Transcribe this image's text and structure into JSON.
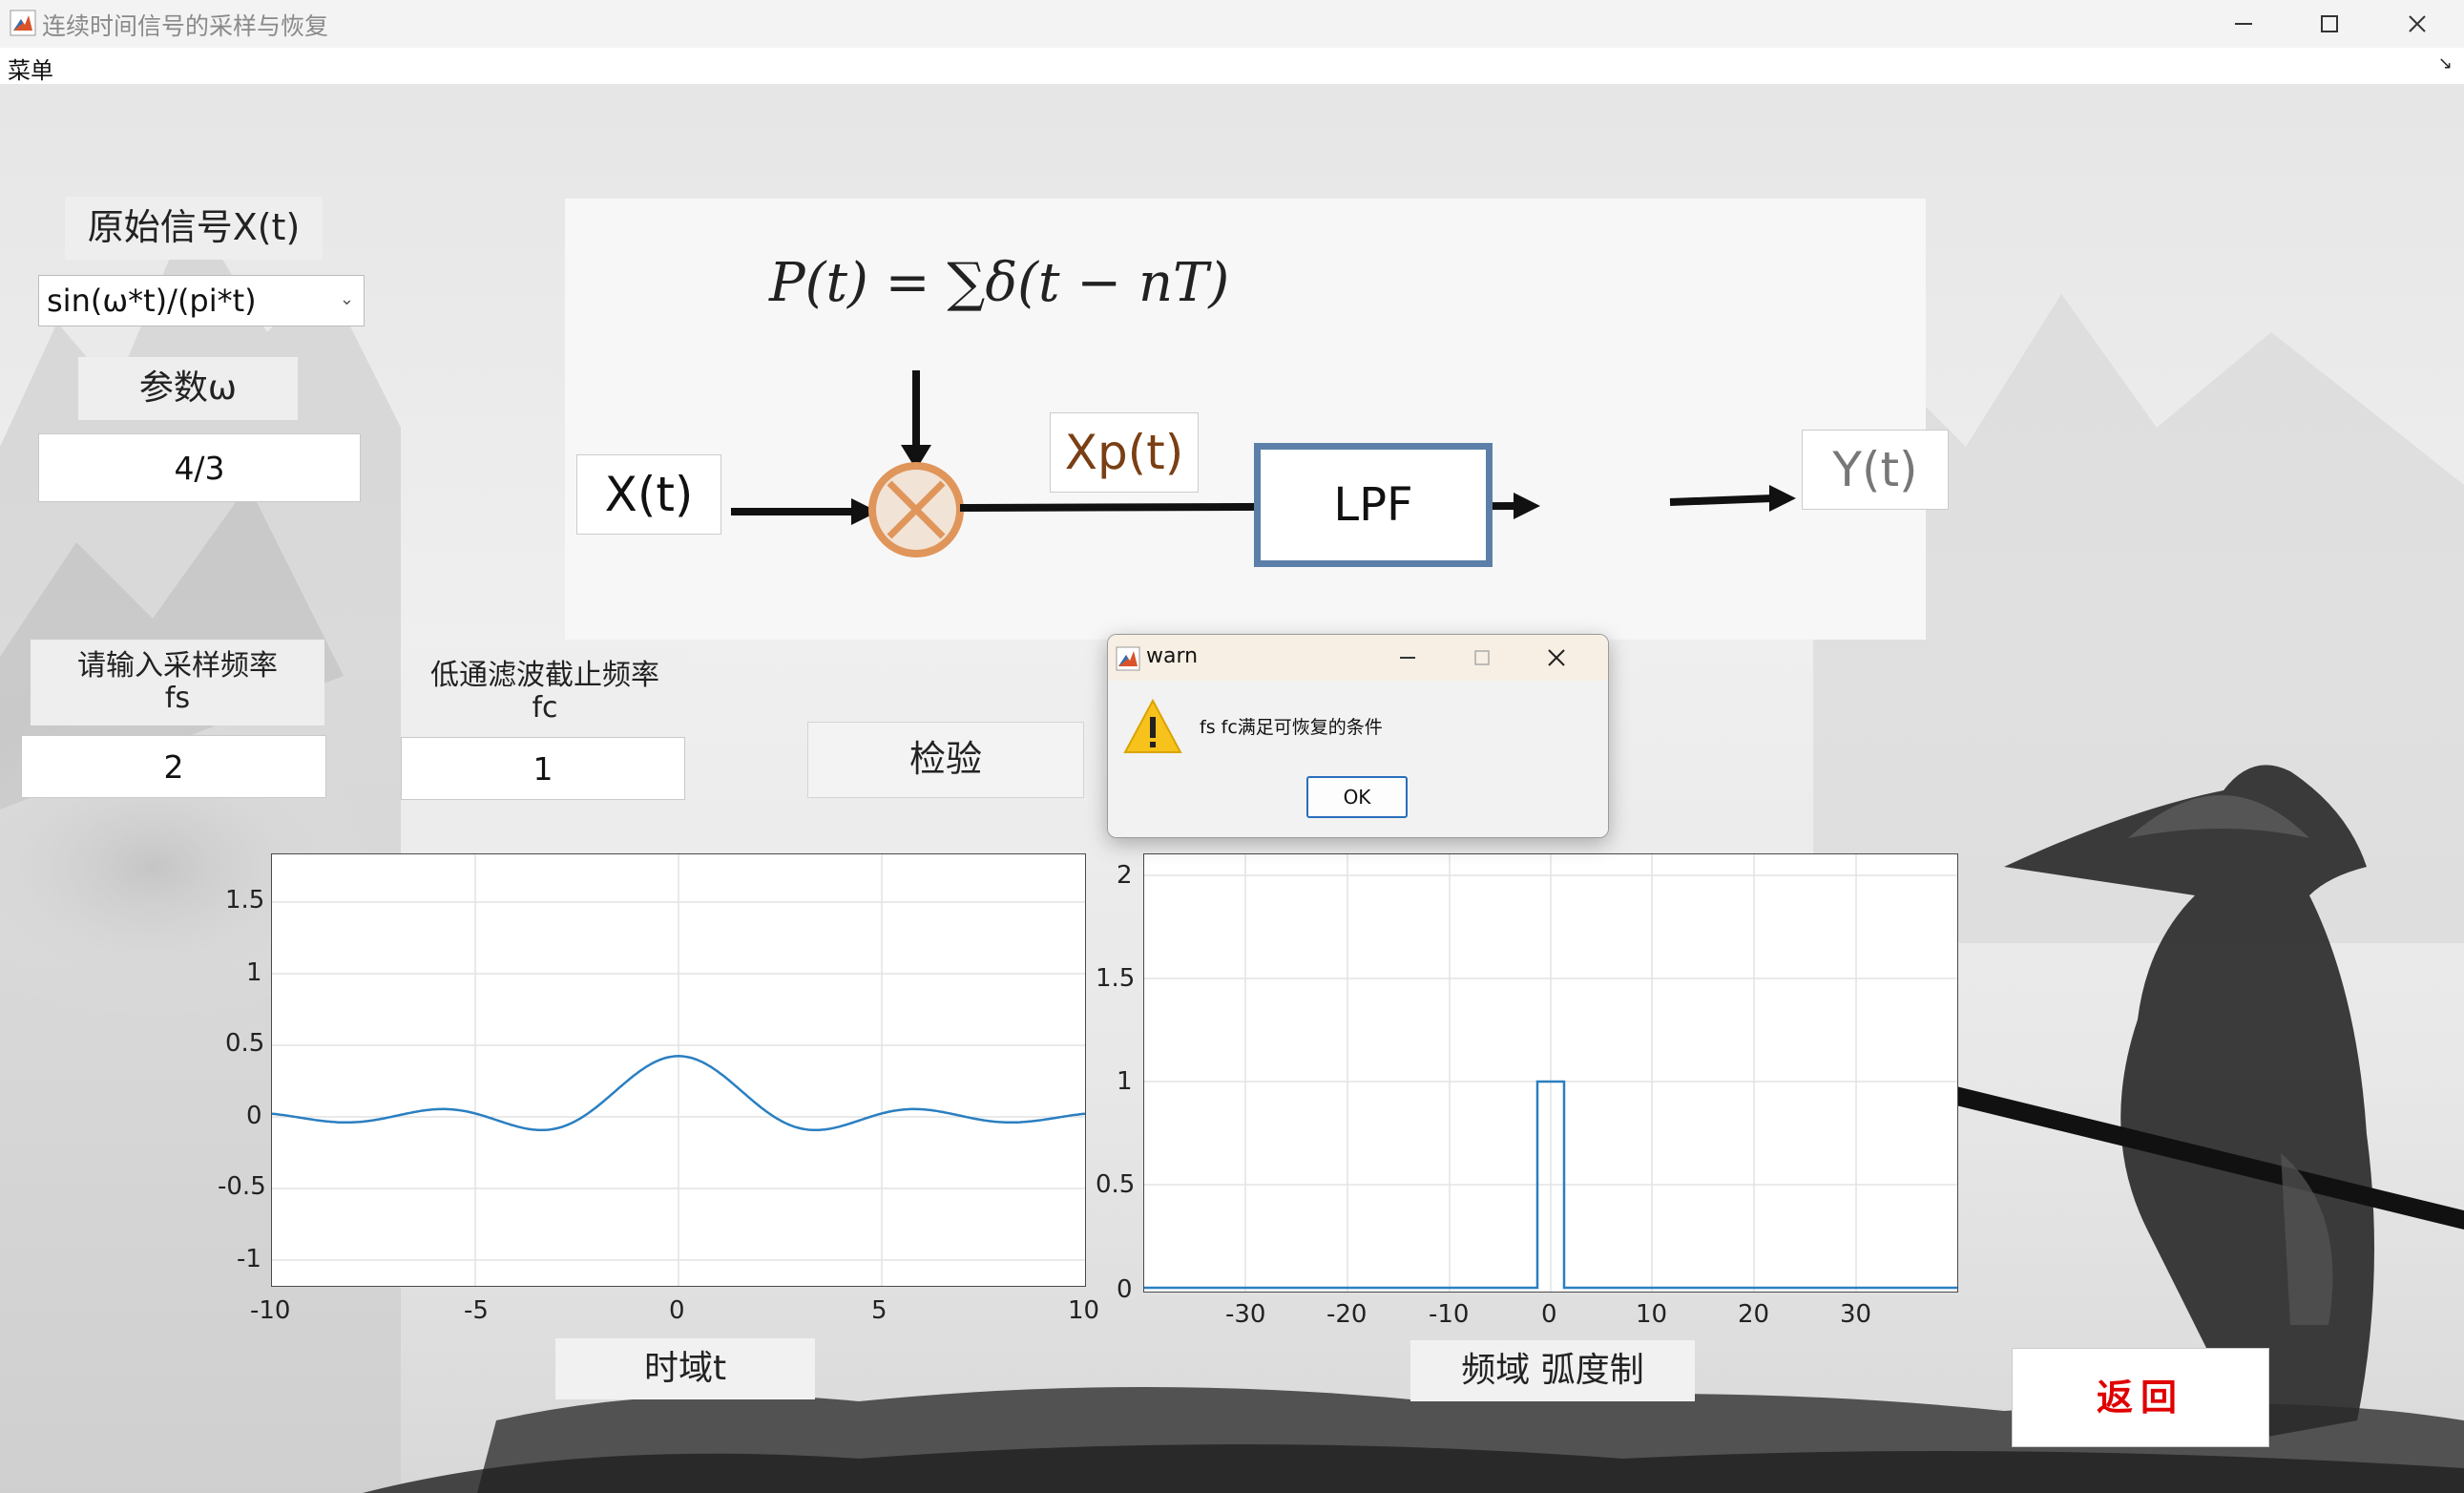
{
  "window": {
    "title": "连续时间信号的采样与恢复"
  },
  "menu": {
    "label": "菜单",
    "arrow": "↘"
  },
  "controls": {
    "signal_label": "原始信号X(t)",
    "signal_select": "sin(ω*t)/(pi*t)",
    "param_label": "参数ω",
    "param_value": "4/3",
    "fs_label_1": "请输入采样频率",
    "fs_label_2": "fs",
    "fs_value": "2",
    "fc_label_1": "低通滤波截止频率",
    "fc_label_2": "fc",
    "fc_value": "1",
    "check_button": "检验",
    "back_button": "返回"
  },
  "diagram": {
    "formula": "P(t) = ∑δ(t − nT)",
    "input_label": "X(t)",
    "mid_label": "Xp(t)",
    "filter_label": "LPF",
    "output_label": "Y(t)"
  },
  "time_plot": {
    "xlabel": "时域t",
    "yticks": [
      "1.5",
      "1",
      "0.5",
      "0",
      "-0.5",
      "-1"
    ],
    "xticks": [
      "-10",
      "-5",
      "0",
      "5",
      "10"
    ]
  },
  "freq_plot": {
    "xlabel": "频域 弧度制",
    "yticks": [
      "2",
      "1.5",
      "1",
      "0.5",
      "0"
    ],
    "xticks": [
      "-30",
      "-20",
      "-10",
      "0",
      "10",
      "20",
      "30"
    ]
  },
  "dialog": {
    "title": "warn",
    "message": "fs fc满足可恢复的条件",
    "ok": "OK"
  },
  "colors": {
    "line": "#2a7fc1",
    "accent_red": "#e00000",
    "lpf_border": "#5b7fa8",
    "multiplier": "#e0955a"
  }
}
